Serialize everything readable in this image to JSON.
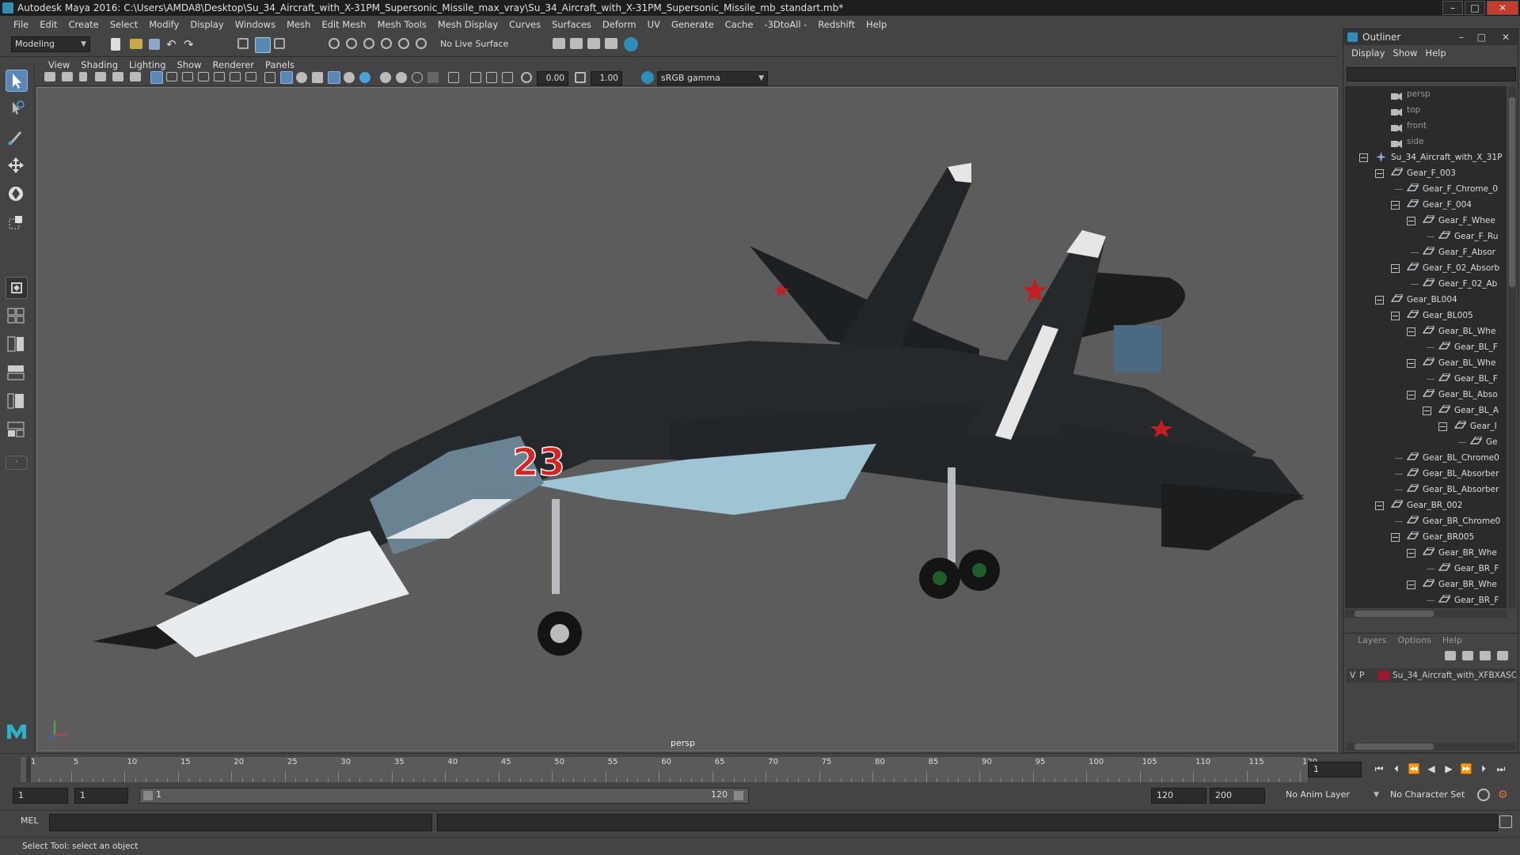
{
  "window": {
    "title": "Autodesk Maya 2016: C:\\Users\\AMDA8\\Desktop\\Su_34_Aircraft_with_X-31PM_Supersonic_Missile_max_vray\\Su_34_Aircraft_with_X-31PM_Supersonic_Missile_mb_standart.mb*"
  },
  "menubar": [
    "File",
    "Edit",
    "Create",
    "Select",
    "Modify",
    "Display",
    "Windows",
    "Mesh",
    "Edit Mesh",
    "Mesh Tools",
    "Mesh Display",
    "Curves",
    "Surfaces",
    "Deform",
    "UV",
    "Generate",
    "Cache",
    "-3DtoAll -",
    "Redshift",
    "Help"
  ],
  "shelf": {
    "mode": "Modeling",
    "live_surface": "No Live Surface"
  },
  "viewport": {
    "menu": [
      "View",
      "Shading",
      "Lighting",
      "Show",
      "Renderer",
      "Panels"
    ],
    "exposure": "0.00",
    "gamma": "1.00",
    "color_space": "sRGB gamma",
    "camera_label": "persp",
    "model_number": "23"
  },
  "outliner": {
    "title": "Outliner",
    "menu": [
      "Display",
      "Show",
      "Help"
    ],
    "items": [
      {
        "label": "persp",
        "depth": 0,
        "kind": "camera"
      },
      {
        "label": "top",
        "depth": 0,
        "kind": "camera"
      },
      {
        "label": "front",
        "depth": 0,
        "kind": "camera"
      },
      {
        "label": "side",
        "depth": 0,
        "kind": "camera"
      },
      {
        "label": "Su_34_Aircraft_with_X_31P",
        "depth": 0,
        "kind": "root",
        "expanded": true
      },
      {
        "label": "Gear_F_003",
        "depth": 1,
        "kind": "mesh",
        "expanded": true
      },
      {
        "label": "Gear_F_Chrome_0",
        "depth": 2,
        "kind": "mesh"
      },
      {
        "label": "Gear_F_004",
        "depth": 2,
        "kind": "mesh",
        "expanded": true
      },
      {
        "label": "Gear_F_Whee",
        "depth": 3,
        "kind": "mesh",
        "expanded": true
      },
      {
        "label": "Gear_F_Ru",
        "depth": 4,
        "kind": "mesh"
      },
      {
        "label": "Gear_F_Absor",
        "depth": 3,
        "kind": "mesh"
      },
      {
        "label": "Gear_F_02_Absorb",
        "depth": 2,
        "kind": "mesh",
        "expanded": true
      },
      {
        "label": "Gear_F_02_Ab",
        "depth": 3,
        "kind": "mesh"
      },
      {
        "label": "Gear_BL004",
        "depth": 1,
        "kind": "mesh",
        "expanded": true
      },
      {
        "label": "Gear_BL005",
        "depth": 2,
        "kind": "mesh",
        "expanded": true
      },
      {
        "label": "Gear_BL_Whe",
        "depth": 3,
        "kind": "mesh",
        "expanded": true
      },
      {
        "label": "Gear_BL_F",
        "depth": 4,
        "kind": "mesh"
      },
      {
        "label": "Gear_BL_Whe",
        "depth": 3,
        "kind": "mesh",
        "expanded": true
      },
      {
        "label": "Gear_BL_F",
        "depth": 4,
        "kind": "mesh"
      },
      {
        "label": "Gear_BL_Abso",
        "depth": 3,
        "kind": "mesh",
        "expanded": true
      },
      {
        "label": "Gear_BL_A",
        "depth": 4,
        "kind": "mesh",
        "expanded": true
      },
      {
        "label": "Gear_I",
        "depth": 5,
        "kind": "mesh",
        "expanded": true
      },
      {
        "label": "Ge",
        "depth": 6,
        "kind": "mesh"
      },
      {
        "label": "Gear_BL_Chrome0",
        "depth": 2,
        "kind": "mesh"
      },
      {
        "label": "Gear_BL_Absorber",
        "depth": 2,
        "kind": "mesh"
      },
      {
        "label": "Gear_BL_Absorber",
        "depth": 2,
        "kind": "mesh"
      },
      {
        "label": "Gear_BR_002",
        "depth": 1,
        "kind": "mesh",
        "expanded": true
      },
      {
        "label": "Gear_BR_Chrome0",
        "depth": 2,
        "kind": "mesh"
      },
      {
        "label": "Gear_BR005",
        "depth": 2,
        "kind": "mesh",
        "expanded": true
      },
      {
        "label": "Gear_BR_Whe",
        "depth": 3,
        "kind": "mesh",
        "expanded": true
      },
      {
        "label": "Gear_BR_F",
        "depth": 4,
        "kind": "mesh"
      },
      {
        "label": "Gear_BR_Whe",
        "depth": 3,
        "kind": "mesh",
        "expanded": true
      },
      {
        "label": "Gear_BR_F",
        "depth": 4,
        "kind": "mesh"
      }
    ]
  },
  "layers": {
    "menu": [
      "Layers",
      "Options",
      "Help"
    ],
    "layer": {
      "v": "V",
      "p": "P",
      "name": "Su_34_Aircraft_with_XFBXASC",
      "color": "#a0182e"
    }
  },
  "timeline": {
    "ticks": [
      "1",
      "5",
      "10",
      "15",
      "20",
      "25",
      "30",
      "35",
      "40",
      "45",
      "50",
      "55",
      "60",
      "65",
      "70",
      "75",
      "80",
      "85",
      "90",
      "95",
      "100",
      "105",
      "110",
      "115",
      "120"
    ],
    "current_frame": "1"
  },
  "range": {
    "start": "1",
    "playback_start": "1",
    "slider_start": "1",
    "slider_end": "120",
    "playback_end": "120",
    "end": "200",
    "anim_layer": "No Anim Layer",
    "character_set": "No Character Set"
  },
  "command": {
    "language": "MEL"
  },
  "helpline": "Select Tool: select an object",
  "colors": {
    "accent": "#2d8fb8",
    "layer": "#a0182e",
    "aircraft_body": "#232628",
    "aircraft_belly": "#9fc4d4",
    "star_red": "#c41e20"
  }
}
